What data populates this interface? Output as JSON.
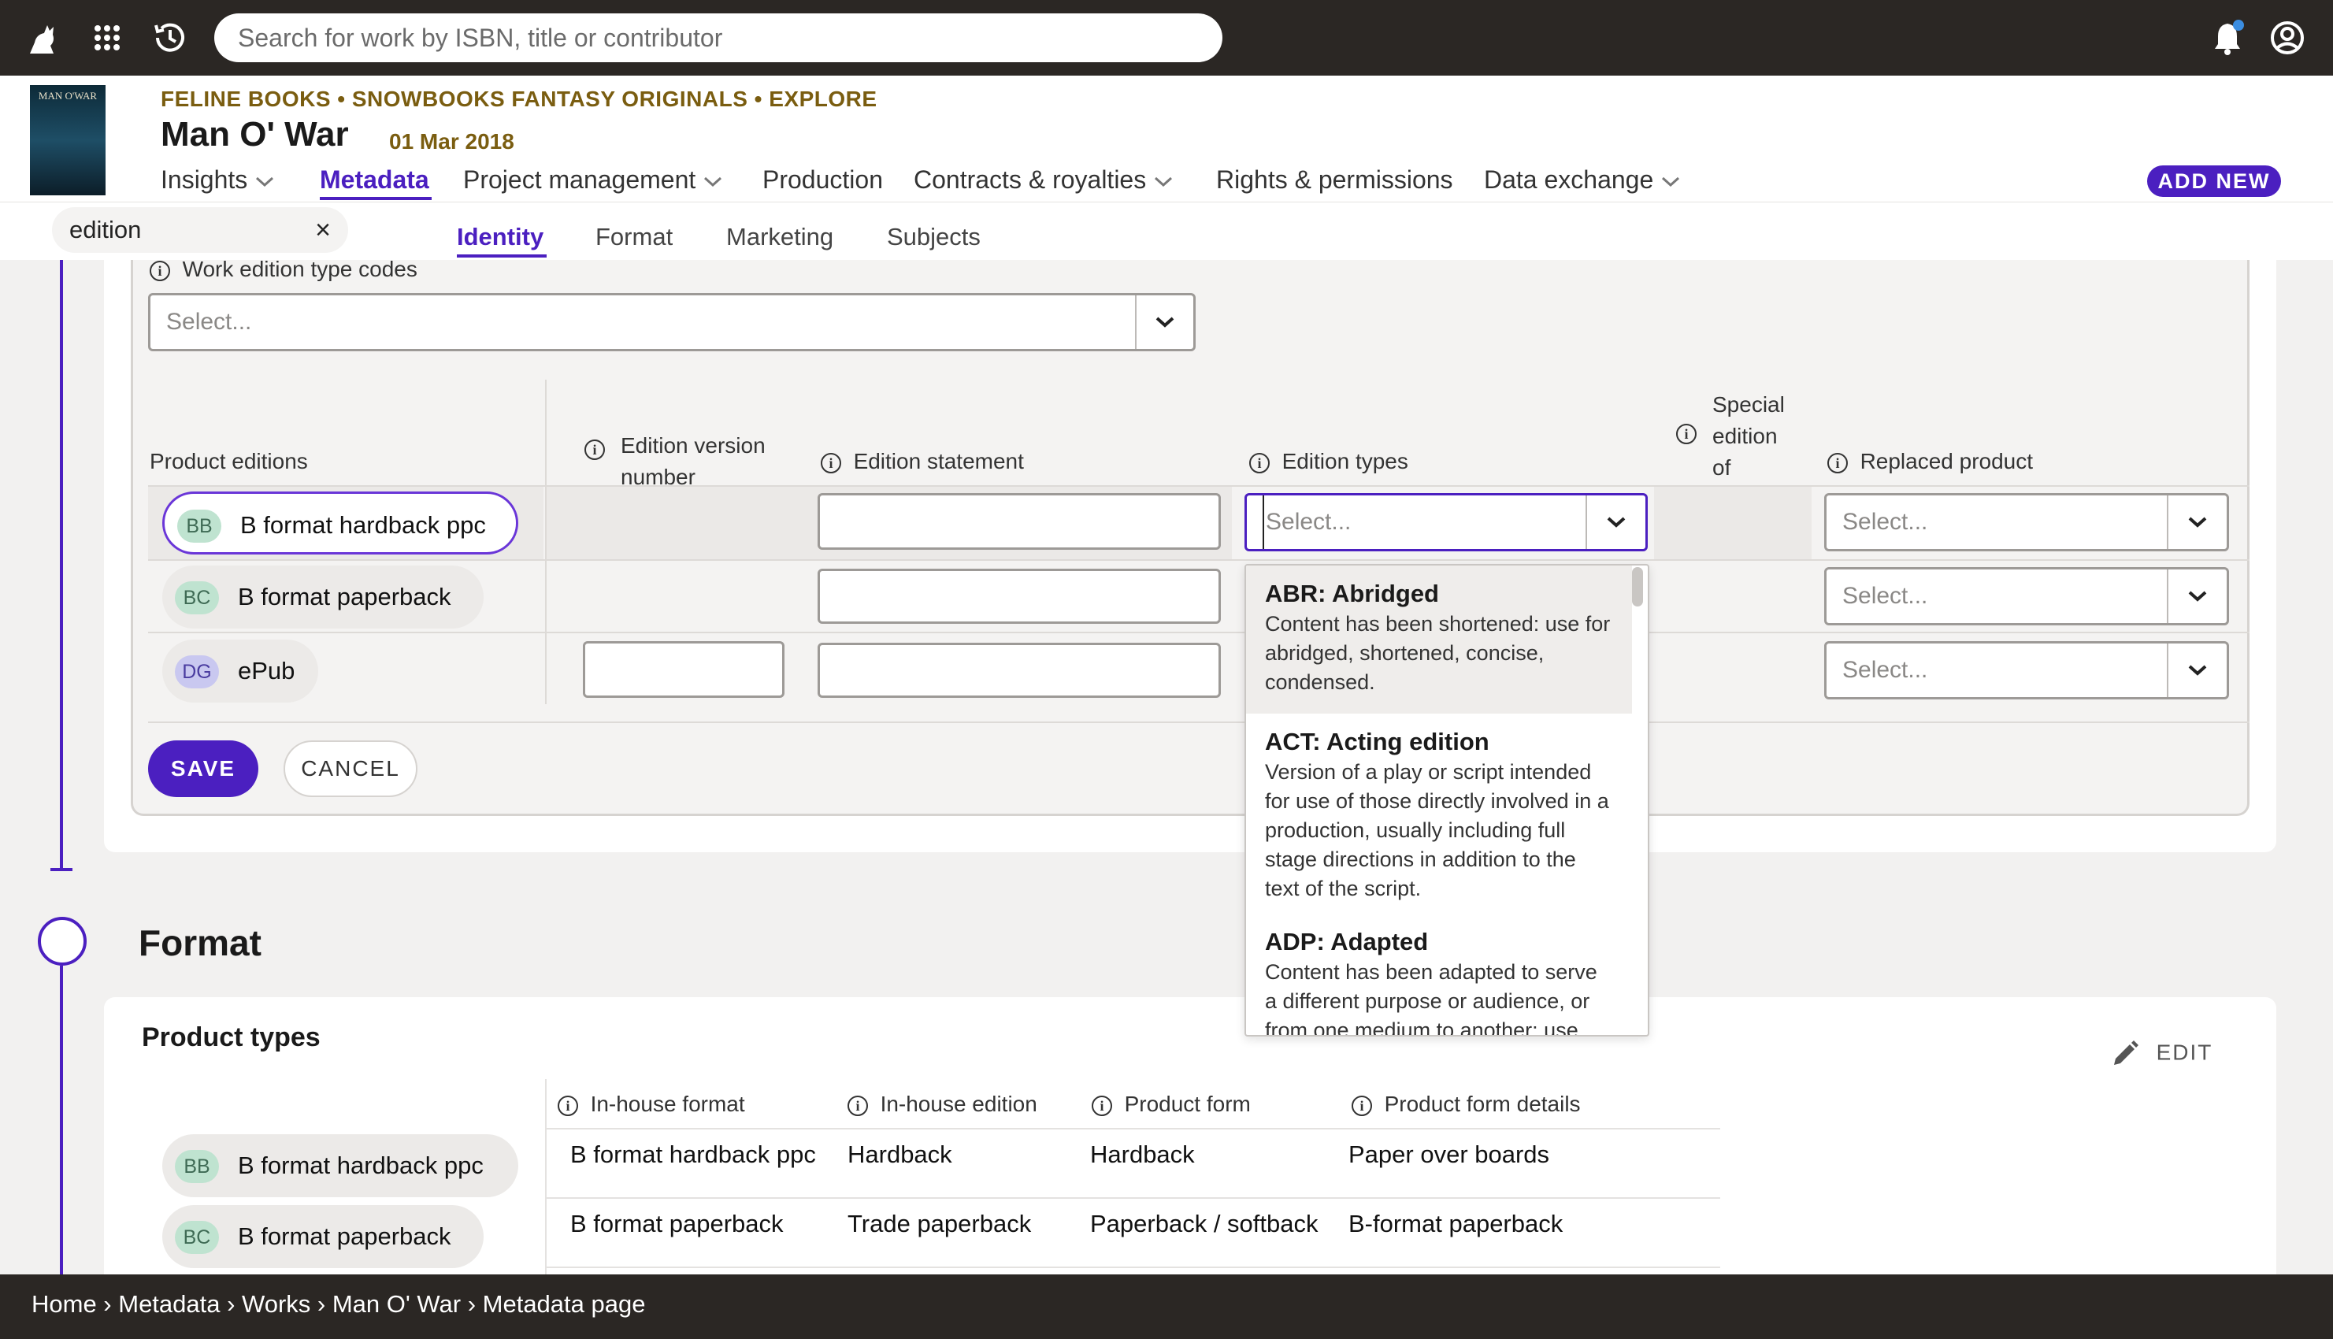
{
  "topbar": {
    "search_placeholder": "Search for work by ISBN, title or contributor"
  },
  "header": {
    "cover_text": "MAN O'WAR",
    "imprint": "FELINE BOOKS • SNOWBOOKS FANTASY ORIGINALS • EXPLORE",
    "title": "Man O' War",
    "date": "01 Mar 2018",
    "nav": [
      {
        "label": "Insights"
      },
      {
        "label": "Metadata"
      },
      {
        "label": "Project management"
      },
      {
        "label": "Production"
      },
      {
        "label": "Contracts & royalties"
      },
      {
        "label": "Rights & permissions"
      },
      {
        "label": "Data exchange"
      }
    ],
    "add_new": "ADD NEW"
  },
  "subnav": {
    "filter_value": "edition",
    "tabs": [
      "Identity",
      "Format",
      "Marketing",
      "Subjects"
    ]
  },
  "identity": {
    "work_edition_label": "Work edition type codes",
    "select_placeholder": "Select...",
    "product_editions_label": "Product editions",
    "columns": {
      "version": [
        "Edition version",
        "number"
      ],
      "statement": "Edition statement",
      "types": "Edition types",
      "special": [
        "Special",
        "edition",
        "of"
      ],
      "replaced": "Replaced product"
    },
    "products": [
      {
        "initials": "BB",
        "name": "B format hardback ppc"
      },
      {
        "initials": "BC",
        "name": "B format paperback"
      },
      {
        "initials": "DG",
        "name": "ePub"
      }
    ],
    "save": "SAVE",
    "cancel": "CANCEL"
  },
  "dropdown": {
    "options": [
      {
        "title": "ABR: Abridged",
        "desc": "Content has been shortened: use for abridged, shortened, concise, condensed."
      },
      {
        "title": "ACT: Acting edition",
        "desc": "Version of a play or script intended for use of those directly involved in a production, usually including full stage directions in addition to the text of the script."
      },
      {
        "title": "ADP: Adapted",
        "desc": "Content has been adapted to serve a different purpose or audience, or from one medium to another: use"
      }
    ]
  },
  "format": {
    "heading": "Format",
    "product_types": "Product types",
    "edit": "EDIT",
    "columns": [
      "In-house format",
      "In-house edition",
      "Product form",
      "Product form details"
    ],
    "products": [
      {
        "initials": "BB",
        "name": "B format hardback ppc"
      },
      {
        "initials": "BC",
        "name": "B format paperback"
      }
    ],
    "rows": [
      [
        "B format hardback ppc",
        "Hardback",
        "Hardback",
        "Paper over boards"
      ],
      [
        "B format paperback",
        "Trade paperback",
        "Paperback / softback",
        "B-format paperback"
      ]
    ]
  },
  "breadcrumb": "Home › Metadata › Works › Man O' War › Metadata page"
}
